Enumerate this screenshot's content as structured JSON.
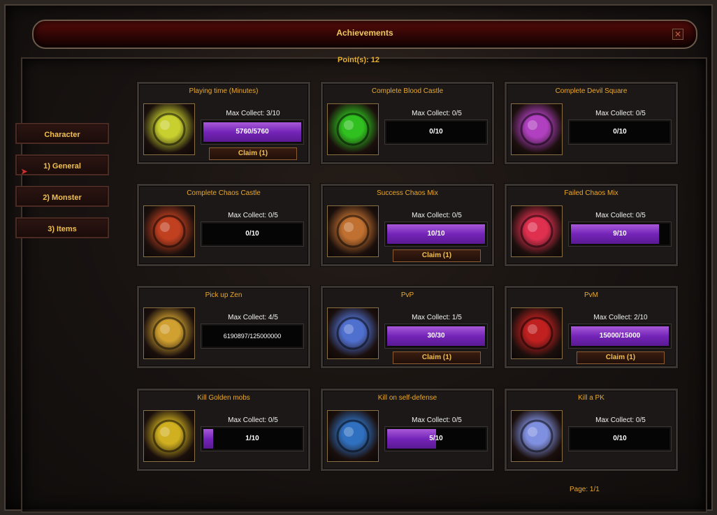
{
  "window": {
    "title": "Achievements"
  },
  "points": "Point(s): 12",
  "sidebar": {
    "items": [
      {
        "label": "Character",
        "active": false
      },
      {
        "label": "1) General",
        "active": true
      },
      {
        "label": "2) Monster",
        "active": false
      },
      {
        "label": "3) Items",
        "active": false
      }
    ]
  },
  "achievements": [
    {
      "title": "Playing time (Minutes)",
      "max": "Max Collect: 3/10",
      "progress": "5760/5760",
      "fill": 1.0,
      "claim": "Claim (1)",
      "icon": "golden-egg-icon",
      "color": "#c8d030"
    },
    {
      "title": "Complete Blood Castle",
      "max": "Max Collect: 0/5",
      "progress": "0/10",
      "fill": 0.0,
      "claim": "",
      "icon": "biohazard-icon",
      "color": "#30c020"
    },
    {
      "title": "Complete Devil Square",
      "max": "Max Collect: 0/5",
      "progress": "0/10",
      "fill": 0.0,
      "claim": "",
      "icon": "devil-face-icon",
      "color": "#b040c0"
    },
    {
      "title": "Complete Chaos Castle",
      "max": "Max Collect: 0/5",
      "progress": "0/10",
      "fill": 0.0,
      "claim": "",
      "icon": "horned-skull-icon",
      "color": "#c04020"
    },
    {
      "title": "Success Chaos Mix",
      "max": "Max Collect: 0/5",
      "progress": "10/10",
      "fill": 1.0,
      "claim": "Claim (1)",
      "icon": "grinning-mask-icon",
      "color": "#c07030"
    },
    {
      "title": "Failed Chaos Mix",
      "max": "Max Collect: 0/5",
      "progress": "9/10",
      "fill": 0.9,
      "claim": "",
      "icon": "broken-heart-icon",
      "color": "#e03050"
    },
    {
      "title": "Pick up Zen",
      "max": "Max Collect: 4/5",
      "progress": "6190897/125000000",
      "fill": 0.0,
      "claim": "",
      "icon": "horn-icon",
      "color": "#d0a030"
    },
    {
      "title": "PvP",
      "max": "Max Collect: 1/5",
      "progress": "30/30",
      "fill": 1.0,
      "claim": "Claim (1)",
      "icon": "crossed-swords-icon",
      "color": "#5070d0"
    },
    {
      "title": "PvM",
      "max": "Max Collect: 2/10",
      "progress": "15000/15000",
      "fill": 1.0,
      "claim": "Claim (1)",
      "icon": "monster-head-icon",
      "color": "#c02020"
    },
    {
      "title": "Kill Golden mobs",
      "max": "Max Collect: 0/5",
      "progress": "1/10",
      "fill": 0.1,
      "claim": "",
      "icon": "golden-serpent-icon",
      "color": "#d0b020"
    },
    {
      "title": "Kill on self-defense",
      "max": "Max Collect: 0/5",
      "progress": "5/10",
      "fill": 0.5,
      "claim": "",
      "icon": "shield-icon",
      "color": "#3070c0"
    },
    {
      "title": "Kill a PK",
      "max": "Max Collect: 0/5",
      "progress": "0/10",
      "fill": 0.0,
      "claim": "",
      "icon": "ghost-skull-icon",
      "color": "#8090e0"
    }
  ],
  "pager": {
    "label": "Page: 1/1"
  }
}
